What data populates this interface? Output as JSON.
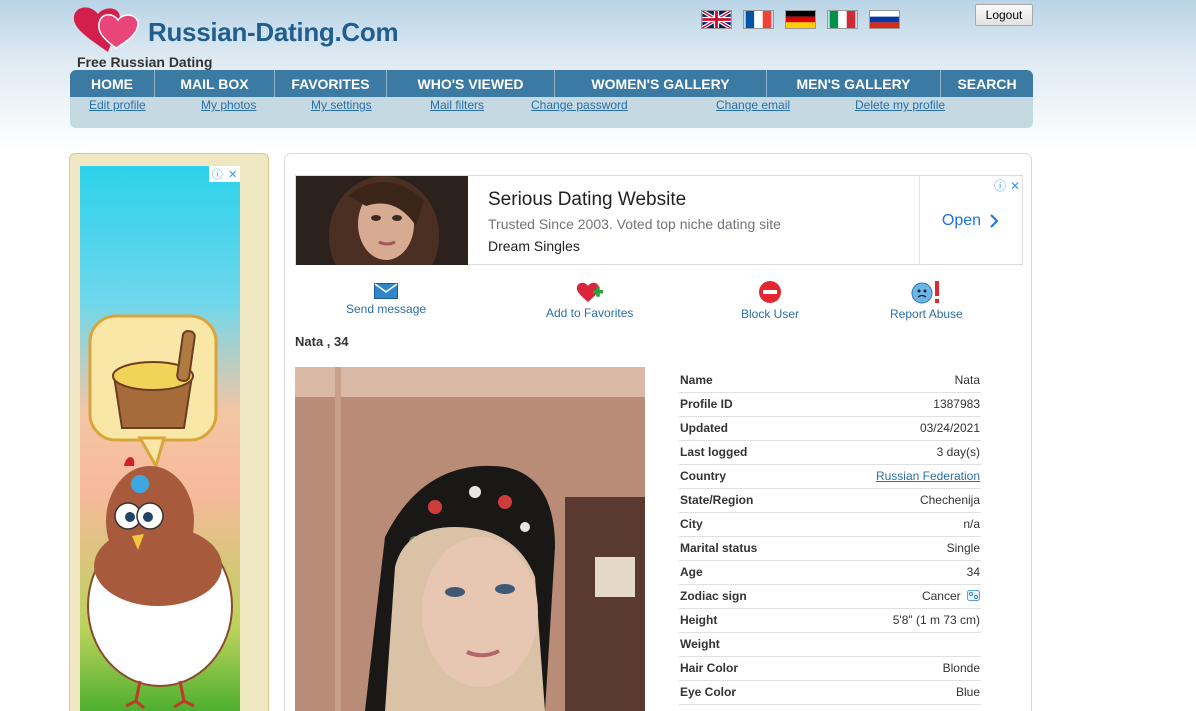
{
  "header": {
    "logo_text": "Russian-Dating.Com",
    "tagline": "Free Russian Dating",
    "logout_label": "Logout",
    "flags": [
      "english-flag",
      "french-flag",
      "german-flag",
      "italian-flag",
      "russian-flag"
    ]
  },
  "nav": {
    "main": [
      "HOME",
      "MAIL BOX",
      "FAVORITES",
      "WHO'S VIEWED",
      "WOMEN'S GALLERY",
      "MEN'S GALLERY",
      "SEARCH"
    ],
    "sub": [
      "Edit profile",
      "My photos",
      "My settings",
      "Mail filters",
      "Change password",
      "Change email",
      "Delete my profile"
    ]
  },
  "ad": {
    "title": "Serious Dating Website",
    "subtitle": "Trusted Since 2003. Voted top niche dating site",
    "brand": "Dream Singles",
    "open_label": "Open"
  },
  "actions": {
    "send_message": "Send message",
    "add_favorites": "Add to Favorites",
    "block_user": "Block User",
    "report_abuse": "Report Abuse"
  },
  "profile": {
    "heading": "Nata , 34",
    "fields": [
      {
        "label": "Name",
        "value": "Nata"
      },
      {
        "label": "Profile ID",
        "value": "1387983"
      },
      {
        "label": "Updated",
        "value": "03/24/2021"
      },
      {
        "label": "Last logged",
        "value": "3 day(s)"
      },
      {
        "label": "Country",
        "value": "Russian Federation"
      },
      {
        "label": "State/Region",
        "value": "Chechenija"
      },
      {
        "label": "City",
        "value": "n/a"
      },
      {
        "label": "Marital status",
        "value": "Single"
      },
      {
        "label": "Age",
        "value": "34"
      },
      {
        "label": "Zodiac sign",
        "value": "Cancer"
      },
      {
        "label": "Height",
        "value": "5'8\" (1 m 73 cm)"
      },
      {
        "label": "Weight",
        "value": ""
      },
      {
        "label": "Hair Color",
        "value": "Blonde"
      },
      {
        "label": "Eye Color",
        "value": "Blue"
      }
    ]
  },
  "colors": {
    "nav_bg": "#3b7ba3",
    "subnav_bg": "#c5d9e3",
    "link": "#2a6fa6",
    "logo": "#1f5e8e",
    "ad_link": "#1a73e8"
  }
}
